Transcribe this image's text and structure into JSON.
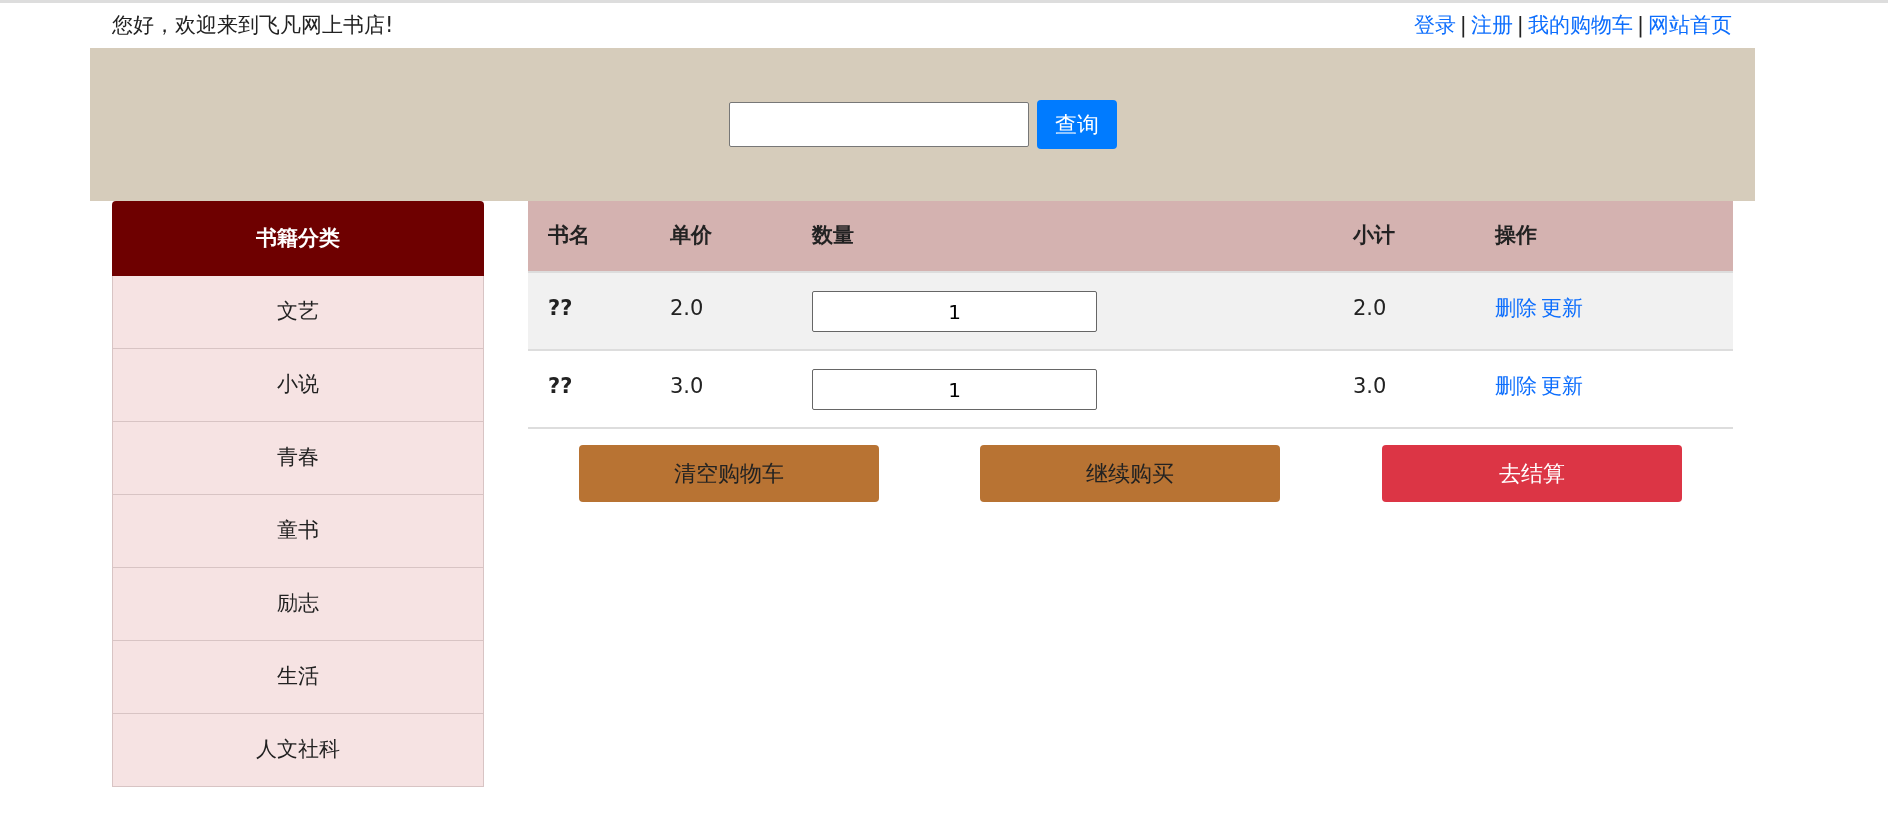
{
  "greeting": "您好，欢迎来到飞凡网上书店!",
  "top_links": [
    {
      "label": "登录"
    },
    {
      "separator": "|"
    },
    {
      "label": "注册"
    },
    {
      "separator": "|"
    },
    {
      "label": "我的购物车"
    },
    {
      "separator": "|"
    },
    {
      "label": "网站首页"
    }
  ],
  "search": {
    "button": "查询"
  },
  "sidebar": {
    "title": "书籍分类",
    "items": [
      "文艺",
      "小说",
      "青春",
      "童书",
      "励志",
      "生活",
      "人文社科"
    ]
  },
  "table": {
    "columns": [
      "书名",
      "单价",
      "数量",
      "小计",
      "操作"
    ],
    "rows": [
      {
        "name": "??",
        "price": "2.0",
        "quantity": "1",
        "subtotal": "2.0",
        "actions": [
          "删除",
          "更新"
        ]
      },
      {
        "name": "??",
        "price": "3.0",
        "quantity": "1",
        "subtotal": "3.0",
        "actions": [
          "删除",
          "更新"
        ]
      }
    ]
  },
  "buttons": [
    {
      "label": "清空购物车",
      "kind": "secondary"
    },
    {
      "label": "继续购买",
      "kind": "secondary"
    },
    {
      "label": "去结算",
      "kind": "primary"
    }
  ]
}
